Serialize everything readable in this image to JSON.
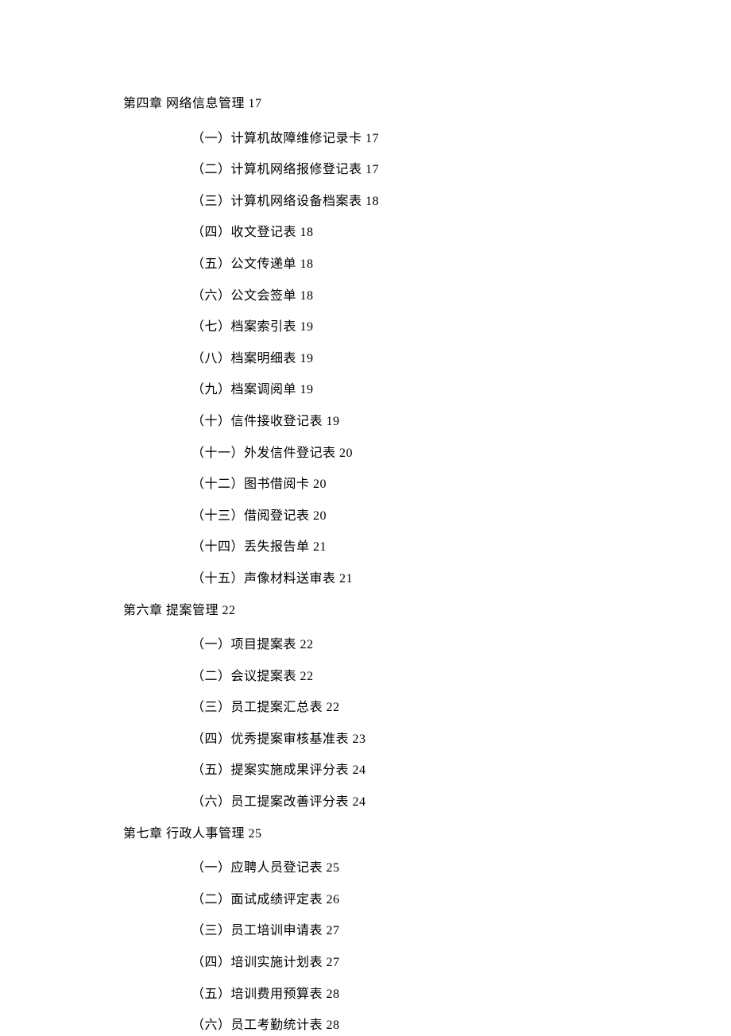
{
  "chapters": [
    {
      "title": "第四章  网络信息管理 17",
      "items": [
        "（一）计算机故障维修记录卡 17",
        "（二）计算机网络报修登记表 17",
        "（三）计算机网络设备档案表 18",
        "（四）收文登记表 18",
        "（五）公文传递单 18",
        "（六）公文会签单 18",
        "（七）档案索引表 19",
        "（八）档案明细表 19",
        "（九）档案调阅单 19",
        "（十）信件接收登记表 19",
        "（十一）外发信件登记表 20",
        "（十二）图书借阅卡 20",
        "（十三）借阅登记表 20",
        "（十四）丢失报告单 21",
        "（十五）声像材料送审表 21"
      ]
    },
    {
      "title": "第六章  提案管理 22",
      "items": [
        "（一）项目提案表 22",
        "（二）会议提案表 22",
        "（三）员工提案汇总表 22",
        "（四）优秀提案审核基准表 23",
        "（五）提案实施成果评分表 24",
        "（六）员工提案改善评分表 24"
      ]
    },
    {
      "title": "第七章  行政人事管理 25",
      "items": [
        "（一）应聘人员登记表 25",
        "（二）面试成绩评定表 26",
        "（三）员工培训申请表 27",
        "（四）培训实施计划表 27",
        "（五）培训费用预算表 28",
        "（六）员工考勤统计表 28"
      ]
    }
  ]
}
